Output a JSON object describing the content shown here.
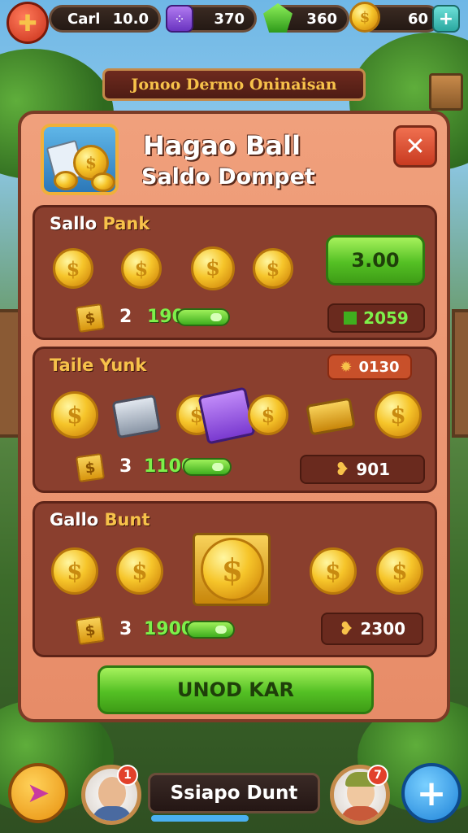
{
  "top_bar": {
    "resource_1": {
      "label": "Carl",
      "value": "10.0"
    },
    "resource_2": {
      "value": "370"
    },
    "resource_3": {
      "value": "360"
    },
    "resource_4": {
      "value": "60"
    }
  },
  "banner": "Jonoo Dermo Oninaisan",
  "panel": {
    "title": "Hagao Ball",
    "subtitle": "Saldo Dompet",
    "sections": [
      {
        "title_a": "Sallo ",
        "title_b": "Pank",
        "count": "2",
        "progress_label": "190",
        "button_label": "3.00",
        "amount": "2059"
      },
      {
        "title": "Taile Yunk",
        "count": "3",
        "progress_label": "1100",
        "badge": "0130",
        "amount": "901"
      },
      {
        "title_a": "Gallo ",
        "title_b": "Bunt",
        "count": "3",
        "progress_label": "1900",
        "amount": "2300"
      }
    ],
    "main_button": "UNOD KAR"
  },
  "bottom_bar": {
    "player_name": "Ssiapo Dunt",
    "left_badge": "1",
    "right_badge": "7"
  },
  "colors": {
    "accent_green": "#54c024",
    "panel": "#e78c68",
    "section": "#8a3f2e",
    "gold": "#f6c52a"
  }
}
